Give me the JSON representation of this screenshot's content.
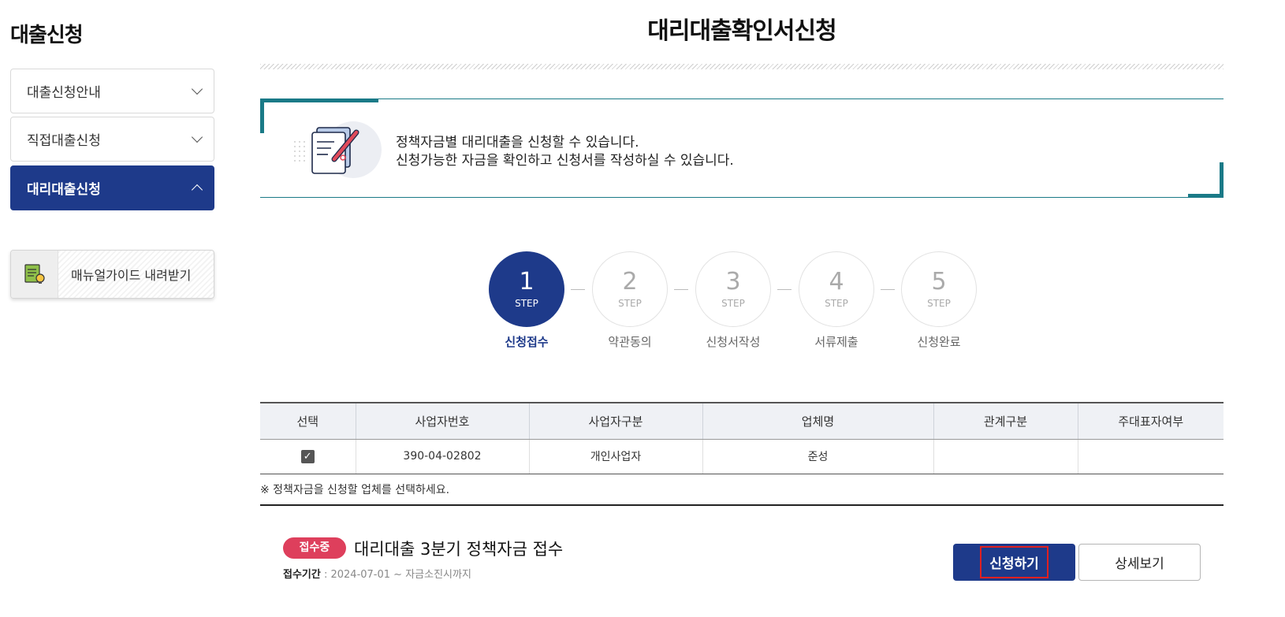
{
  "sidebar": {
    "title": "대출신청",
    "items": [
      {
        "label": "대출신청안내",
        "expanded": false
      },
      {
        "label": "직접대출신청",
        "expanded": false
      },
      {
        "label": "대리대출신청",
        "expanded": true
      }
    ],
    "manual_label": "매뉴얼가이드 내려받기",
    "accent_color": "#1e3a8a"
  },
  "page": {
    "title": "대리대출확인서신청"
  },
  "intro": {
    "line1": "정책자금별 대리대출을 신청할 수 있습니다.",
    "line2": "신청가능한 자금을 확인하고 신청서를 작성하실 수 있습니다.",
    "icon": "document-pen-icon",
    "accent_color": "#1a7a87"
  },
  "steps": [
    {
      "number": "1",
      "unit": "STEP",
      "label": "신청접수",
      "active": true
    },
    {
      "number": "2",
      "unit": "STEP",
      "label": "약관동의",
      "active": false
    },
    {
      "number": "3",
      "unit": "STEP",
      "label": "신청서작성",
      "active": false
    },
    {
      "number": "4",
      "unit": "STEP",
      "label": "서류제출",
      "active": false
    },
    {
      "number": "5",
      "unit": "STEP",
      "label": "신청완료",
      "active": false
    }
  ],
  "table": {
    "headers": [
      "선택",
      "사업자번호",
      "사업자구분",
      "업체명",
      "관계구분",
      "주대표자여부"
    ],
    "rows": [
      {
        "checked": true,
        "biz_no": "390-04-02802",
        "biz_type": "개인사업자",
        "company": "준성",
        "relation": "",
        "main_rep": ""
      }
    ]
  },
  "note": "※ 정책자금을 신청할 업체를 선택하세요.",
  "fund": {
    "badge": "접수중",
    "badge_color": "#de3f5c",
    "title": "대리대출 3분기 정책자금 접수",
    "period_label": "접수기간",
    "period_value": " : 2024-07-01 ~ 자금소진시까지",
    "apply_label": "신청하기",
    "detail_label": "상세보기"
  }
}
